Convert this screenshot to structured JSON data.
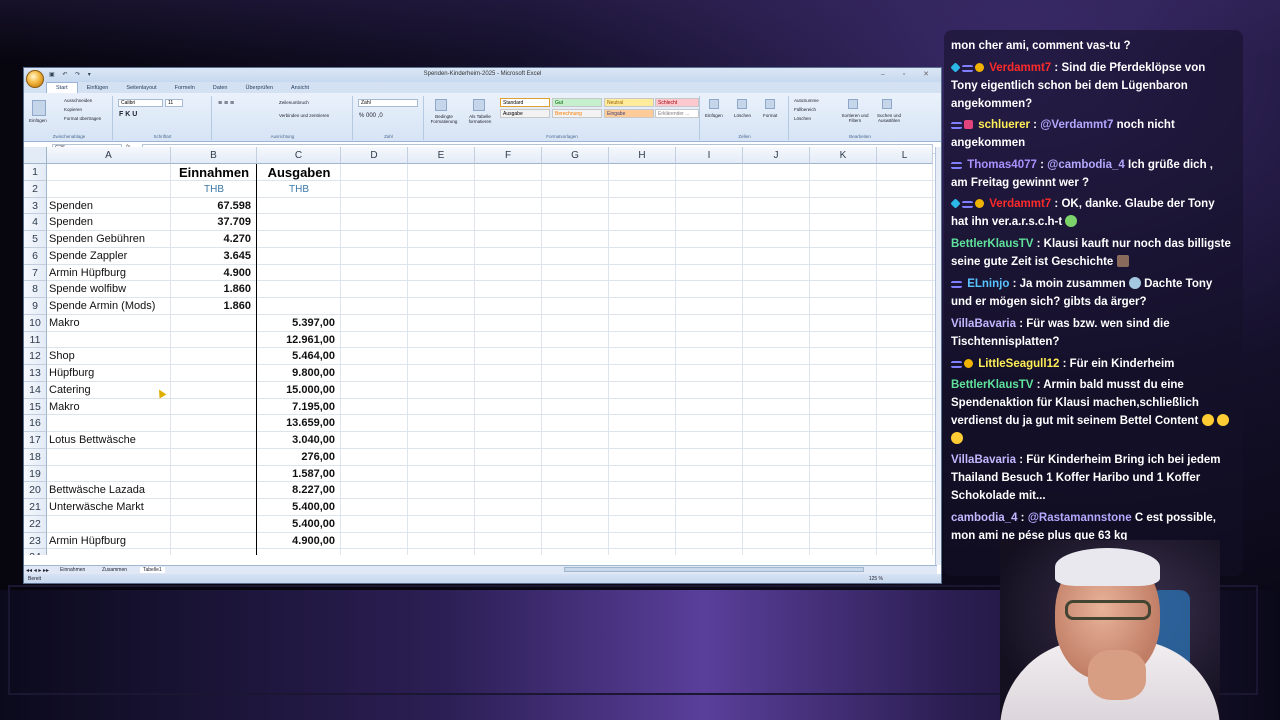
{
  "excel": {
    "title": "Spenden-Kinderheim-2025 - Microsoft Excel",
    "tabs": [
      "Start",
      "Einfügen",
      "Seitenlayout",
      "Formeln",
      "Daten",
      "Überprüfen",
      "Ansicht"
    ],
    "name_box": "C26",
    "ribbon": {
      "clipboard": "Zwischenablage",
      "font": "Schriftart",
      "alignment": "Ausrichtung",
      "number": "Zahl",
      "styles": "Formatvorlagen",
      "cells": "Zellen",
      "editing": "Bearbeiten",
      "paste": "Einfügen",
      "cut": "Ausschneiden",
      "copy": "Kopieren",
      "format_painter": "Format übertragen",
      "font_name": "Calibri",
      "font_size": "11",
      "wrap": "Zeilenumbruch",
      "merge": "Verbinden und zentrieren",
      "number_format": "Zahl",
      "cond_format": "Bedingte Formatierung",
      "as_table": "Als Tabelle formatieren",
      "style_standard": "Standard",
      "style_gut": "Gut",
      "style_neutral": "Neutral",
      "style_schlecht": "Schlecht",
      "style_ausgabe": "Ausgabe",
      "style_berechnung": "Berechnung",
      "style_eingabe": "Eingabe",
      "style_erklaerend": "Erklärender ...",
      "insert": "Einfügen",
      "delete": "Löschen",
      "format": "Format",
      "autosum": "AutoSumme",
      "fill": "Füllbereich",
      "clear": "Löschen",
      "sort": "Sortieren und Filtern",
      "find": "Suchen und Auswählen"
    },
    "columns": [
      "A",
      "B",
      "C",
      "D",
      "E",
      "F",
      "G",
      "H",
      "I",
      "J",
      "K",
      "L"
    ],
    "rows": [
      "1",
      "2",
      "3",
      "4",
      "5",
      "6",
      "7",
      "8",
      "9",
      "10",
      "11",
      "12",
      "13",
      "14",
      "15",
      "16",
      "17",
      "18",
      "19",
      "20",
      "21",
      "22",
      "23",
      "24"
    ],
    "header": {
      "einnahmen": "Einnahmen",
      "ausgaben": "Ausgaben",
      "unit_b": "THB",
      "unit_c": "THB"
    },
    "cells": [
      {
        "a": "",
        "b": "",
        "c": ""
      },
      {
        "a": "",
        "b": "",
        "c": ""
      },
      {
        "a": "Spenden",
        "b": "67.598",
        "c": ""
      },
      {
        "a": "Spenden",
        "b": "37.709",
        "c": ""
      },
      {
        "a": "Spenden Gebühren",
        "b": "4.270",
        "c": ""
      },
      {
        "a": "Spende Zappler",
        "b": "3.645",
        "c": ""
      },
      {
        "a": "Armin Hüpfburg",
        "b": "4.900",
        "c": ""
      },
      {
        "a": "Spende wolfibw",
        "b": "1.860",
        "c": ""
      },
      {
        "a": "Spende Armin (Mods)",
        "b": "1.860",
        "c": ""
      },
      {
        "a": "Makro",
        "b": "",
        "c": "5.397,00"
      },
      {
        "a": "",
        "b": "",
        "c": "12.961,00"
      },
      {
        "a": "Shop",
        "b": "",
        "c": "5.464,00"
      },
      {
        "a": "Hüpfburg",
        "b": "",
        "c": "9.800,00"
      },
      {
        "a": "Catering",
        "b": "",
        "c": "15.000,00"
      },
      {
        "a": "Makro",
        "b": "",
        "c": "7.195,00"
      },
      {
        "a": "",
        "b": "",
        "c": "13.659,00"
      },
      {
        "a": "Lotus Bettwäsche",
        "b": "",
        "c": "3.040,00"
      },
      {
        "a": "",
        "b": "",
        "c": "276,00"
      },
      {
        "a": "",
        "b": "",
        "c": "1.587,00"
      },
      {
        "a": "Bettwäsche Lazada",
        "b": "",
        "c": "8.227,00"
      },
      {
        "a": "Unterwäsche Markt",
        "b": "",
        "c": "5.400,00"
      },
      {
        "a": "",
        "b": "",
        "c": "5.400,00"
      },
      {
        "a": "Armin Hüpfburg",
        "b": "",
        "c": "4.900,00"
      },
      {
        "a": "",
        "b": "",
        "c": ""
      }
    ],
    "sheets": [
      "Einnahmen",
      "Zusammen",
      "Tabelle1"
    ],
    "status": "Bereit",
    "zoom": "125 %"
  },
  "chat": [
    {
      "user": "",
      "text": "mon cher ami, comment vas-tu ?"
    },
    {
      "user": "Verdammt7",
      "text": "Sind die Pferdeklöpse von Tony eigentlich schon bei dem Lügenbaron angekommen?"
    },
    {
      "user": "schluerer",
      "mention": "@Verdammt7",
      "text": "noch nicht angekommen"
    },
    {
      "user": "Thomas4077",
      "mention": "@cambodia_4",
      "text": "Ich grüße dich , am Freitag gewinnt wer ?"
    },
    {
      "user": "Verdammt7",
      "text": "OK, danke. Glaube der Tony hat ihn ver.a.r.s.c.h-t"
    },
    {
      "user": "BettlerKlausTV",
      "text": "Klausi kauft nur noch das billigste seine gute Zeit ist Geschichte"
    },
    {
      "user": "ELninjo",
      "text": "Ja moin zusammen",
      "text2": "Dachte Tony und er mögen sich? gibts da ärger?"
    },
    {
      "user": "VillaBavaria",
      "text": "Für was bzw. wen sind die Tischtennisplatten?"
    },
    {
      "user": "LittleSeagull12",
      "text": "Für ein Kinderheim"
    },
    {
      "user": "BettlerKlausTV",
      "text": "Armin bald musst du eine Spendenaktion für Klausi machen,schließlich verdienst du ja gut mit seinem Bettel Content"
    },
    {
      "user": "VillaBavaria",
      "text": "Für Kinderheim Bring ich bei jedem Thailand Besuch 1 Koffer Haribo und 1 Koffer Schokolade mit..."
    },
    {
      "user": "cambodia_4",
      "mention": "@Rastamannstone",
      "text": "C est possible, mon ami ne pése plus que 63 kg"
    }
  ],
  "colors": {
    "excel_blue": "#d3e1f2",
    "chat_bg": "#14102a"
  }
}
